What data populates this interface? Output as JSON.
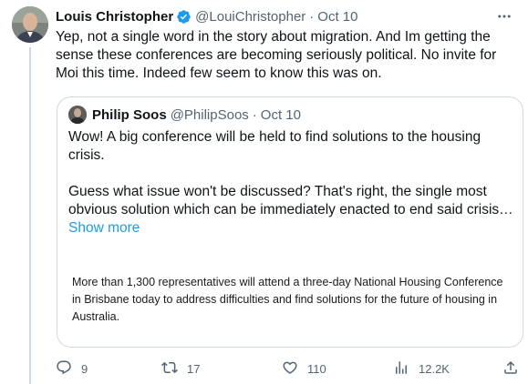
{
  "tweet": {
    "author_name": "Louis Christopher",
    "handle": "@LouiChristopher",
    "separator": "·",
    "date": "Oct 10",
    "text": "Yep, not a single word in the story about migration. And Im getting the sense these conferences are becoming seriously political. No invite for Moi this time. Indeed few seem to know this was on."
  },
  "quote": {
    "author_name": "Philip Soos",
    "handle": "@PhilipSoos",
    "separator": "·",
    "date": "Oct 10",
    "paragraph1": "Wow! A big conference will be held to find solutions to the housing crisis.",
    "paragraph2": "Guess what issue won't be discussed? That's right, the single most obvious solution which can be immediately enacted to end said crisis…",
    "show_more": "Show more",
    "image_text": "More than 1,300 representatives will attend a three-day National Housing Conference in Brisbane today to address difficulties and find solutions for the future of housing in Australia."
  },
  "actions": {
    "replies": "9",
    "retweets": "17",
    "likes": "110",
    "views": "12.2K"
  },
  "icons": {
    "verified": "verified-badge-icon",
    "more": "more-icon",
    "reply": "reply-icon",
    "retweet": "retweet-icon",
    "like": "heart-icon",
    "views": "views-icon",
    "share": "share-icon"
  },
  "colors": {
    "accent": "#1d9bf0",
    "muted": "#536471",
    "border": "#cfd9de",
    "text": "#0f1419"
  }
}
